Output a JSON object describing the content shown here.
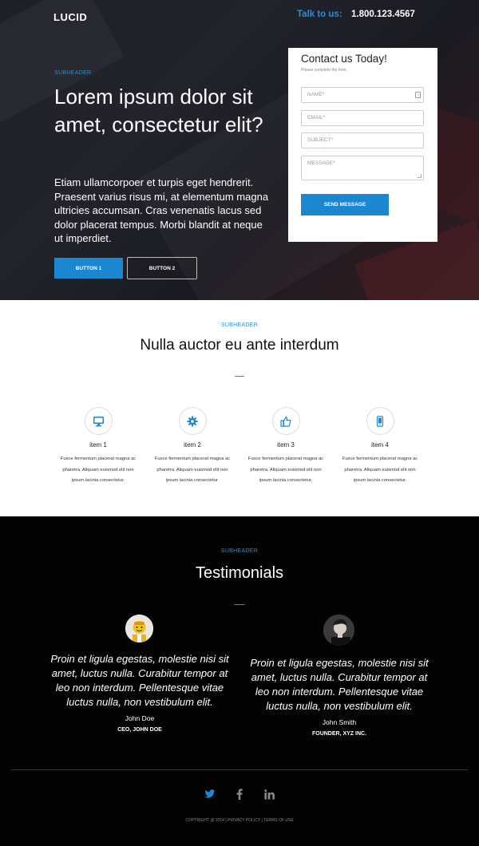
{
  "header": {
    "logo": "LUCID",
    "talk_label": "Talk to us:",
    "phone": "1.800.123.4567"
  },
  "hero": {
    "subheader": "SUBHEADER",
    "title": "Lorem ipsum dolor sit amet, consectetur elit?",
    "text": "Etiam ullamcorpoer et turpis eget hendrerit. Praesent varius risus mi, at elementum magna ultricies accumsan. Cras venenatis lacus sed dolor placerat tempus. Morbi blandit at neque ut imperdiet.",
    "button1": "BUTTON 1",
    "button2": "BUTTON 2"
  },
  "form": {
    "title": "Contact us Today!",
    "subtitle": "Please complete the form.",
    "name_placeholder": "NAME*",
    "email_placeholder": "EMAIL*",
    "subject_placeholder": "SUBJECT*",
    "message_placeholder": "MESSAGE*",
    "send_label": "SEND MESSAGE"
  },
  "features": {
    "subheader": "SUBHEADER",
    "title": "Nulla auctor eu ante interdum",
    "items": [
      {
        "title": "item 1",
        "text": "Fusce fermentum placerat magna ac pharetra. Aliquam euismod elit non ipsum lacinia consectetur.",
        "icon": "monitor-icon"
      },
      {
        "title": "item 2",
        "text": "Fusce fermentum placerat magna ac pharetra. Aliquam euismod elit non ipsum lacinia consectetur.",
        "icon": "gear-icon"
      },
      {
        "title": "item 3",
        "text": "Fusce fermentum placerat magna ac pharetra. Aliquam euismod elit non ipsum lacinia consectetur.",
        "icon": "thumbs-up-icon"
      },
      {
        "title": "item 4",
        "text": "Fusce fermentum placerat magna ac pharetra. Aliquam euismod elit non ipsum lacinia consectetur.",
        "icon": "mobile-icon"
      }
    ]
  },
  "testimonials": {
    "subheader": "SUBHEADER",
    "title": "Testimonials",
    "items": [
      {
        "quote": "Proin et ligula egestas, molestie nisi sit amet, luctus nulla. Curabitur tempor at leo non interdum. Pellentesque vitae luctus nulla, non vestibulum elit.",
        "name": "John Doe",
        "role": "CEO, JOHN DOE"
      },
      {
        "quote": "Proin et ligula egestas, molestie nisi sit amet, luctus nulla. Curabitur tempor at leo non interdum. Pellentesque vitae luctus nulla, non vestibulum elit.",
        "name": "John Smith",
        "role": "FOUNDER, XYZ INC."
      }
    ]
  },
  "footer": {
    "social": [
      "twitter-icon",
      "facebook-icon",
      "linkedin-icon"
    ],
    "copyright": "COPYRIGHT @ 2014 | PRIVACY POLICY | TERMS OF USE"
  },
  "colors": {
    "accent": "#1b87d0",
    "hero_bg": "#1f1f27",
    "dark_bg": "#030303"
  }
}
